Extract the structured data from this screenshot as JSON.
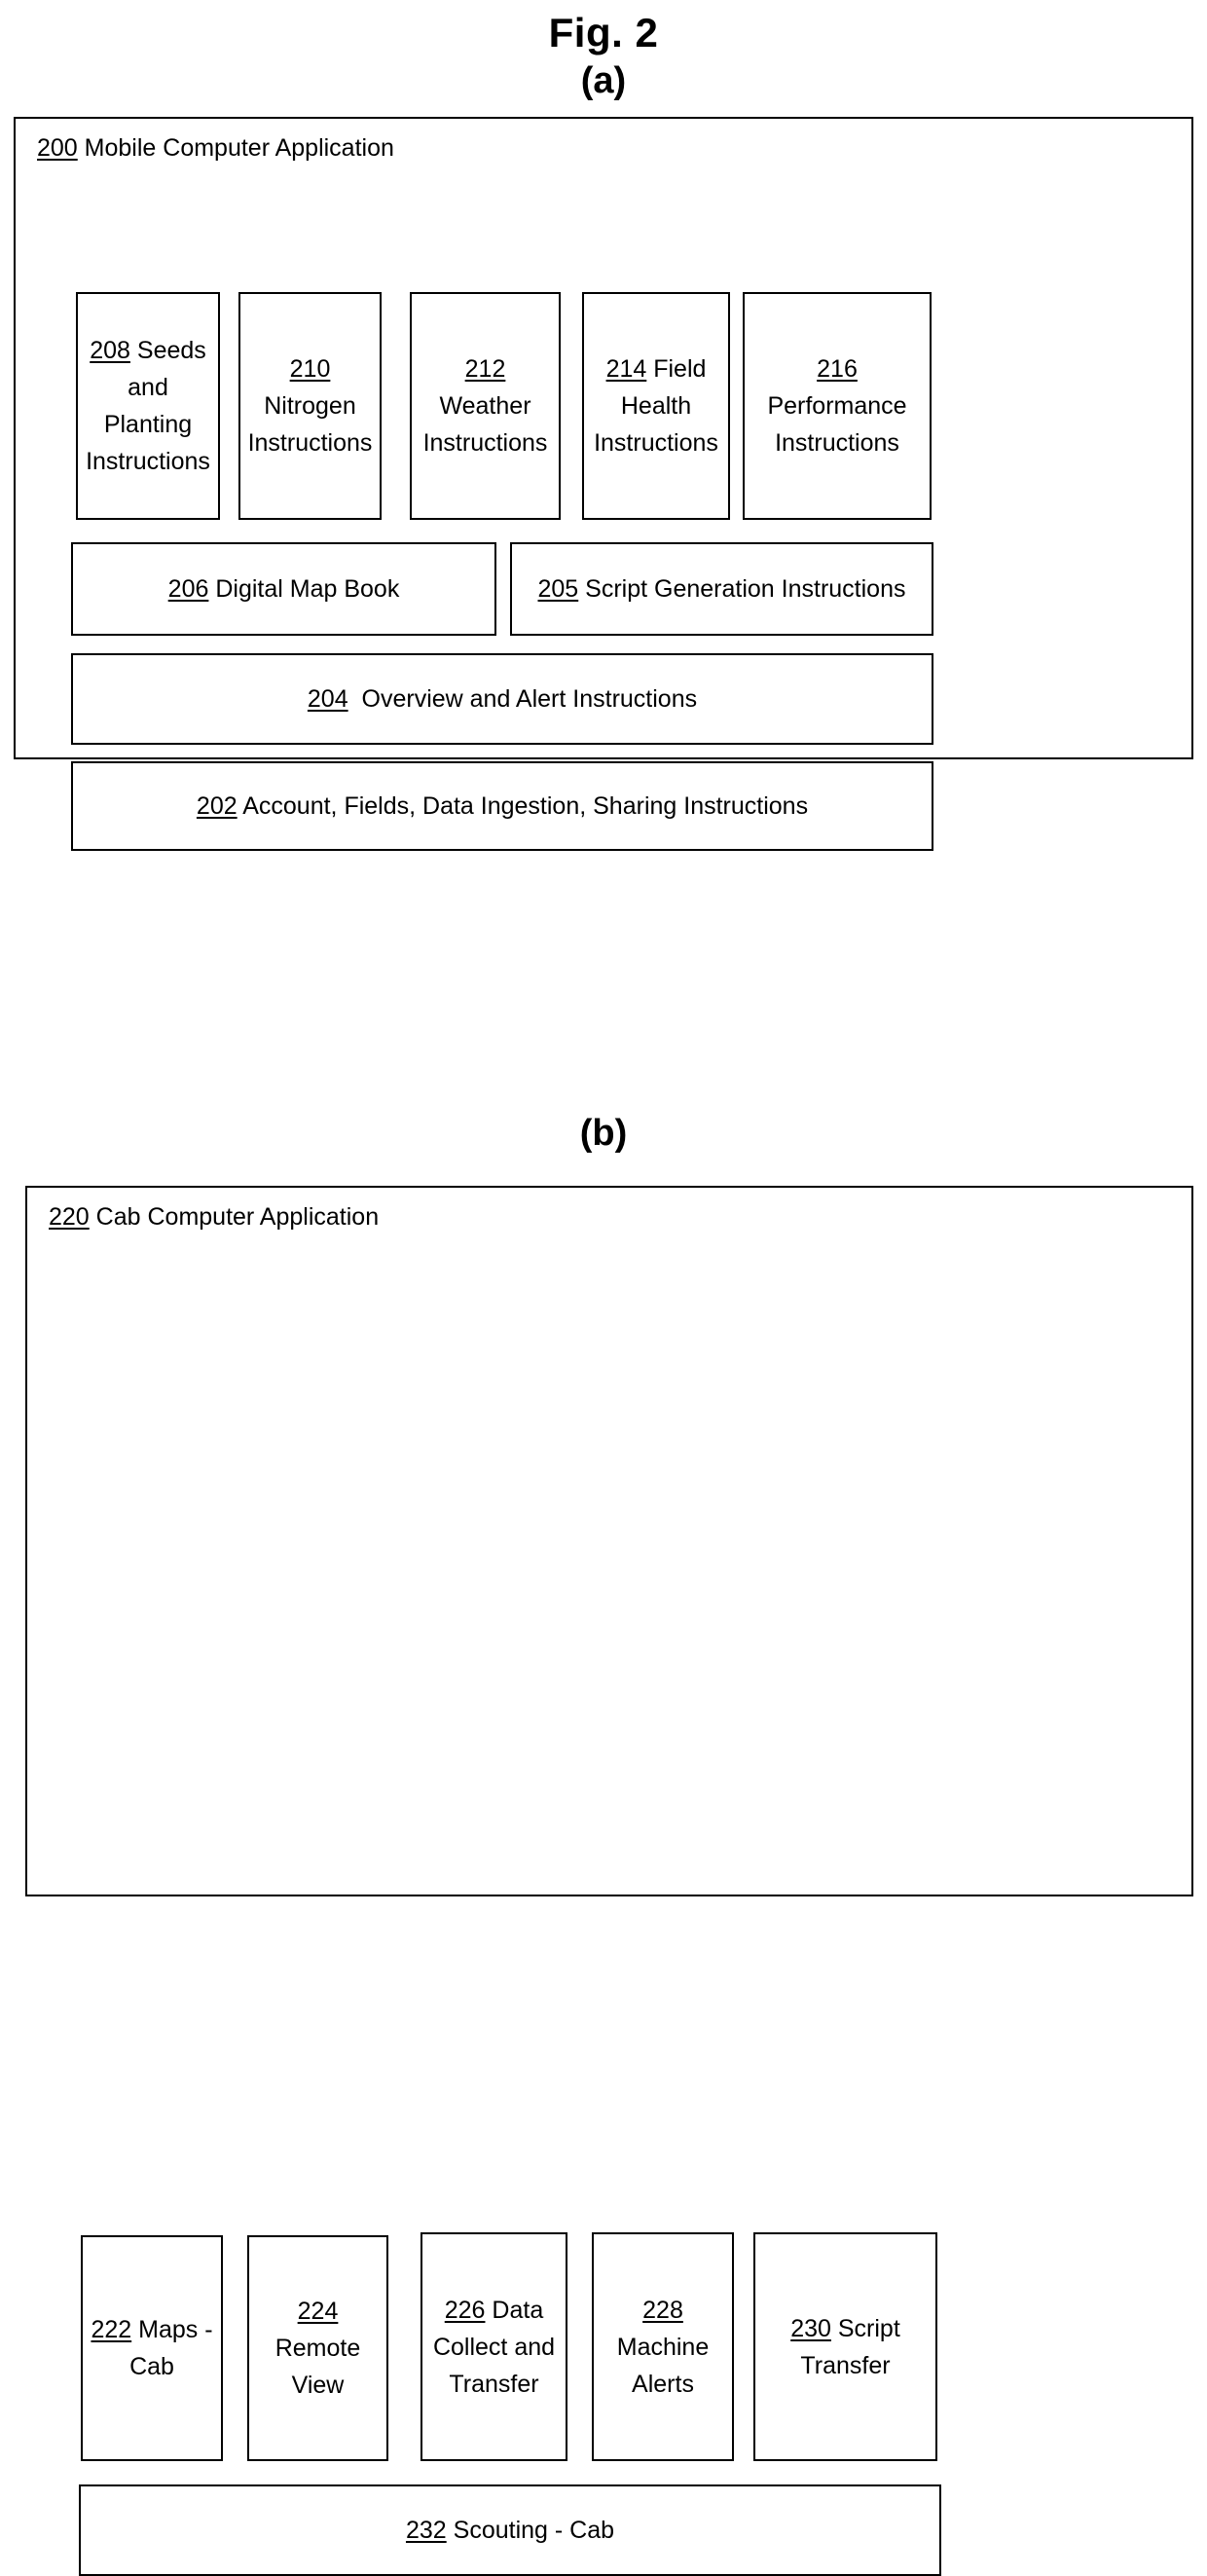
{
  "figure": {
    "title": "Fig. 2",
    "panel_a_letter": "(a)",
    "panel_b_letter": "(b)"
  },
  "panel_a": {
    "container": {
      "ref": "200",
      "label": "Mobile Computer Application"
    },
    "top_boxes": [
      {
        "ref": "208",
        "label": "Seeds and Planting Instructions",
        "line1": "Seeds",
        "line2": "and Planting",
        "line3": "Instructions"
      },
      {
        "ref": "210",
        "label": "Nitrogen Instructions",
        "line1": "",
        "line2": "Nitrogen",
        "line3": "Instructions"
      },
      {
        "ref": "212",
        "label": "Weather Instructions",
        "line1": "",
        "line2": "Weather",
        "line3": "Instructions"
      },
      {
        "ref": "214",
        "label": "Field Health Instructions",
        "line1": "Field",
        "line2": "Health",
        "line3": "Instructions"
      },
      {
        "ref": "216",
        "label": "Performance Instructions",
        "line1": "",
        "line2": "Performance",
        "line3": "Instructions"
      }
    ],
    "rows": [
      {
        "ref": "206",
        "label": "Digital Map Book"
      },
      {
        "ref": "205",
        "label": "Script Generation Instructions"
      },
      {
        "ref": "204",
        "label": "Overview and Alert Instructions"
      },
      {
        "ref": "202",
        "label": "Account, Fields, Data Ingestion, Sharing Instructions"
      }
    ]
  },
  "panel_b": {
    "container": {
      "ref": "220",
      "label": "Cab Computer Application"
    },
    "top_boxes": [
      {
        "ref": "222",
        "label": "Maps - Cab",
        "line1": "Maps -",
        "line2": "Cab",
        "line3": ""
      },
      {
        "ref": "224",
        "label": "Remote View",
        "line1": "Remote",
        "line2": "View",
        "line3": ""
      },
      {
        "ref": "226",
        "label": "Data Collect and Transfer",
        "line1": "Data",
        "line2": "Collect and",
        "line3": "Transfer"
      },
      {
        "ref": "228",
        "label": "Machine Alerts",
        "line1": "",
        "line2": "Machine",
        "line3": "Alerts"
      },
      {
        "ref": "230",
        "label": "Script Transfer",
        "line1": "Script",
        "line2": "Transfer",
        "line3": ""
      }
    ],
    "rows": [
      {
        "ref": "232",
        "label": "Scouting - Cab"
      }
    ]
  },
  "colors": {
    "stroke": "#000000",
    "background": "#ffffff"
  }
}
